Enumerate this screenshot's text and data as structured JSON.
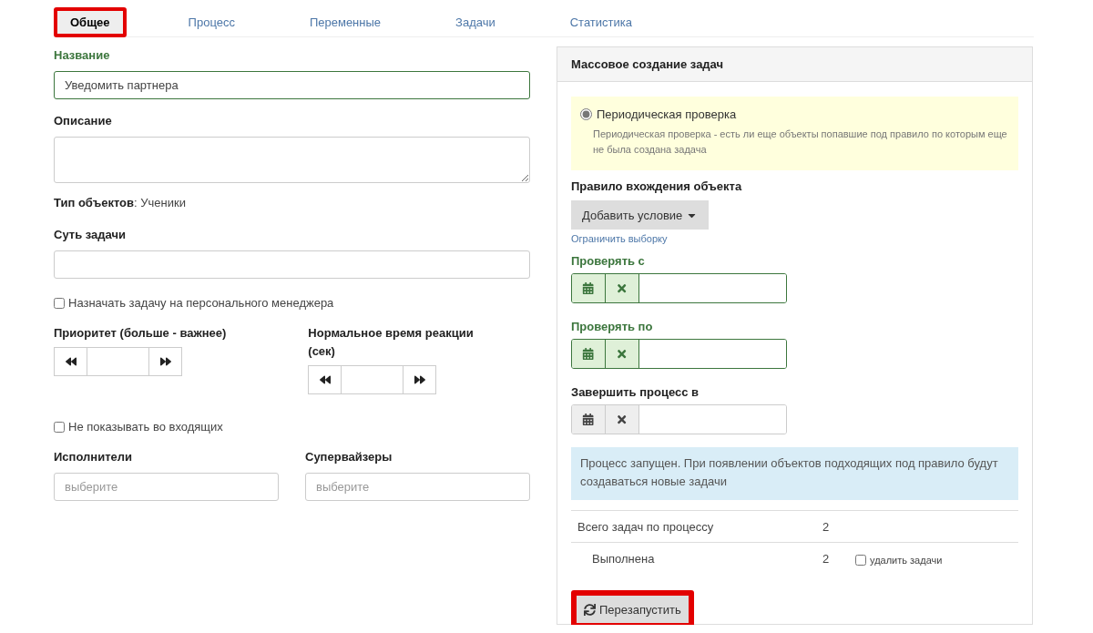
{
  "tabs": [
    {
      "label": "Общее",
      "selected": true,
      "highlighted": true
    },
    {
      "label": "Процесс",
      "selected": false,
      "highlighted": false
    },
    {
      "label": "Переменные",
      "selected": false,
      "highlighted": false
    },
    {
      "label": "Задачи",
      "selected": false,
      "highlighted": false
    },
    {
      "label": "Статистика",
      "selected": false,
      "highlighted": false
    }
  ],
  "form": {
    "name": {
      "label": "Название",
      "value": "Уведомить партнера"
    },
    "description": {
      "label": "Описание"
    },
    "object_type": "**Тип объектов**: Ученики",
    "essence": {
      "label": "Суть задачи"
    },
    "personal_manager": {
      "label": "Назначать задачу на персонального менеджера",
      "checked": false
    },
    "priority": {
      "label": "Приоритет (больше - важнее)"
    },
    "reaction_time": {
      "label": "Нормальное время реакции (сек)"
    },
    "hide_inbox": {
      "label": "Не показывать во входящих",
      "checked": false
    },
    "executors": {
      "label": "Исполнители",
      "placeholder": "выберите"
    },
    "supervisors": {
      "label": "Супервайзеры",
      "placeholder": "выберите"
    }
  },
  "panel": {
    "title": "Массовое создание задач",
    "mode": {
      "label": "Периодическая проверка",
      "selected": true,
      "hint": "Периодическая проверка - есть ли еще объекты попавшие под правило по которым еще не была создана задача"
    },
    "rule_label": "Правило вхождения объекта",
    "add_condition": "Добавить условие",
    "limit_link": "Ограничить выборку",
    "date_fields": [
      {
        "label": "Проверять с",
        "valid": true
      },
      {
        "label": "Проверять по",
        "valid": true
      },
      {
        "label": "Завершить процесс в",
        "valid": false
      }
    ],
    "alert": "Процесс запущен. При появлении объектов подходящих под правило будут создаваться новые задачи",
    "stats": [
      {
        "label": "Всего задач по процессу",
        "value": "2",
        "indented": false
      },
      {
        "label": "Выполнена",
        "value": "2",
        "indented": true,
        "delete": {
          "label": "удалить задачи",
          "checked": false
        }
      }
    ],
    "restart": {
      "label": "Перезапустить",
      "highlighted": true
    }
  }
}
